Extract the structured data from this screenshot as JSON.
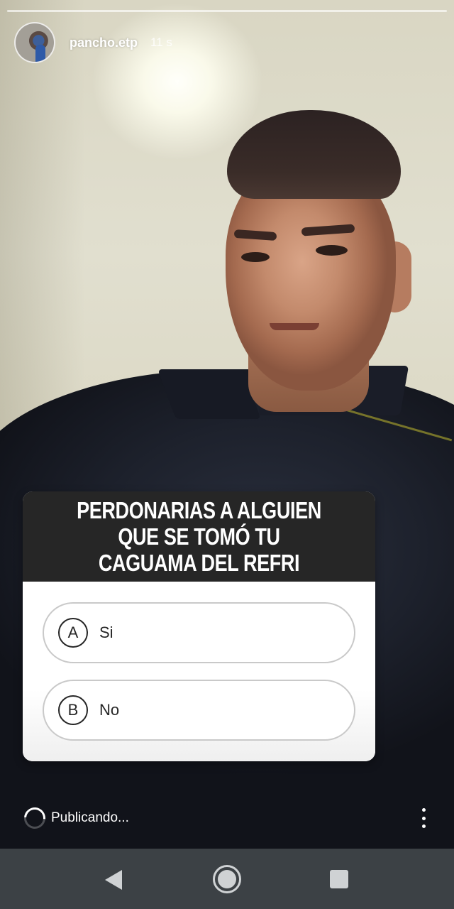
{
  "story": {
    "username": "pancho.etp",
    "time_ago": "11 s",
    "avatar_icon": "user-avatar",
    "progress_color": "#ffffff"
  },
  "quiz": {
    "question": "PERDONARIAS A ALGUIEN QUE SE TOMÓ TU CAGUAMA DEL REFRI",
    "header_color": "#262626",
    "options": [
      {
        "letter": "A",
        "text": "Si"
      },
      {
        "letter": "B",
        "text": "No"
      }
    ]
  },
  "footer": {
    "status_text": "Publicando...",
    "status_icon": "loading-spinner-icon",
    "menu_icon": "more-vertical-icon"
  },
  "navbar": {
    "back_icon": "back-triangle-icon",
    "home_icon": "home-circle-icon",
    "recents_icon": "recents-square-icon",
    "background_color": "#3c4145"
  }
}
